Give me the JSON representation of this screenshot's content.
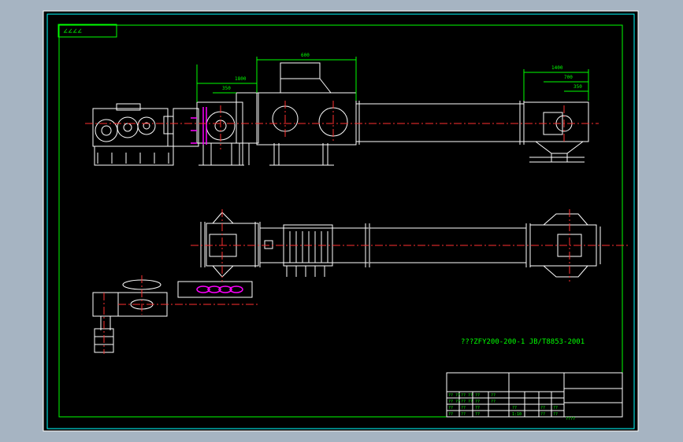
{
  "colors": {
    "background_outer": "#a6b4c2",
    "sheet": "#000000",
    "line_white": "#ffffff",
    "line_green": "#00ff00",
    "line_cyan": "#00ffff",
    "centerline_red": "#ff3030",
    "highlight_magenta": "#ff00ff"
  },
  "corner_note": "∠∠∠∠",
  "caption": "???ZFY200-200-1 JB/T8853-2001",
  "dims_top": {
    "overall": "600",
    "d1": "1800",
    "d2": "350",
    "right_overall": "1400",
    "right_d1": "700",
    "right_d2": "350"
  },
  "title_block": {
    "r1": [
      "?? ??",
      "?? ??",
      "??",
      "??"
    ],
    "r2": [
      "?? ??",
      "?? ??",
      "??",
      "??"
    ],
    "r3": [
      "??",
      "??",
      "??",
      "??",
      "??",
      "??"
    ],
    "scale_row": [
      "??",
      "??",
      "??",
      "1:10",
      "??",
      "??"
    ],
    "footnote": "????"
  }
}
